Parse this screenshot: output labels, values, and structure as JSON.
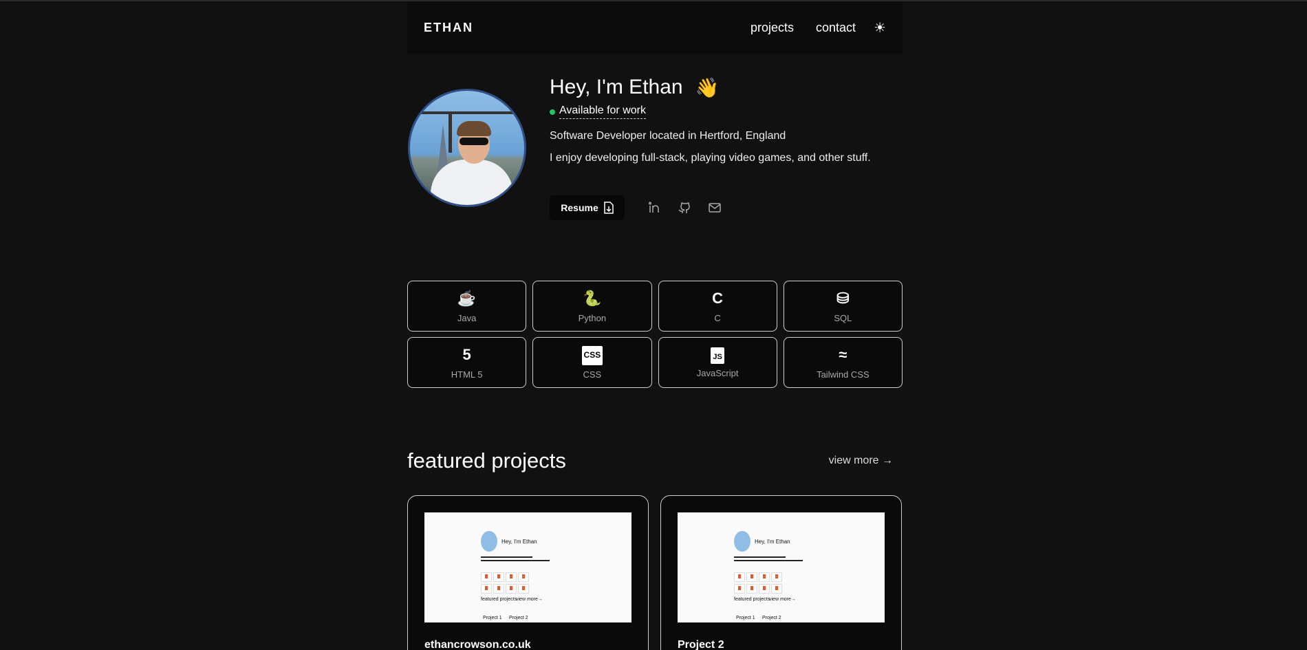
{
  "nav": {
    "logo": "ETHAN",
    "links": [
      "projects",
      "contact"
    ],
    "theme_icon": "sun-icon"
  },
  "hero": {
    "title": "Hey, I'm Ethan",
    "emoji": "👋",
    "status": "Available for work",
    "status_color": "#22c55e",
    "location": "Software Developer located in Hertford, England",
    "bio": "I enjoy developing full-stack, playing video games, and other stuff.",
    "resume_label": "Resume",
    "socials": [
      "linkedin-icon",
      "github-icon",
      "mail-icon"
    ]
  },
  "skills": [
    {
      "label": "Java",
      "icon": "☕"
    },
    {
      "label": "Python",
      "icon": "🐍"
    },
    {
      "label": "C",
      "icon": "C"
    },
    {
      "label": "SQL",
      "icon": "⛁"
    },
    {
      "label": "HTML 5",
      "icon": "5"
    },
    {
      "label": "CSS",
      "icon": "CSS"
    },
    {
      "label": "JavaScript",
      "icon": "JS"
    },
    {
      "label": "Tailwind CSS",
      "icon": "≈"
    }
  ],
  "featured": {
    "heading": "featured projects",
    "view_more": "view more →",
    "projects": [
      {
        "title": "ethancrowson.co.uk",
        "preview": {
          "heading": "Hey, I'm Ethan",
          "section": "featured projects",
          "more": "view more→",
          "p1": "Project 1",
          "p2": "Project 2"
        }
      },
      {
        "title": "Project 2",
        "preview": {
          "heading": "Hey, I'm Ethan",
          "section": "featured projects",
          "more": "view more→",
          "p1": "Project 1",
          "p2": "Project 2"
        }
      }
    ]
  }
}
